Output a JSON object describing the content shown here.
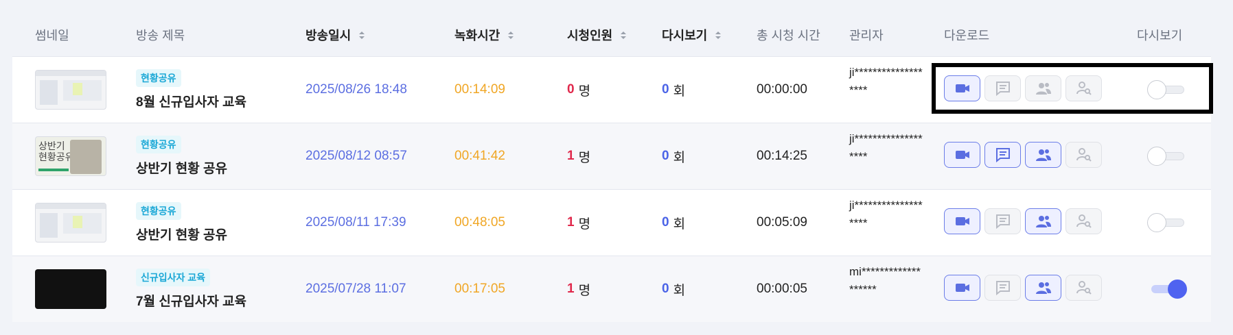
{
  "headers": {
    "thumbnail": "썸네일",
    "title": "방송 제목",
    "date": "방송일시",
    "rec_time": "녹화시간",
    "viewers": "시청인원",
    "replays": "다시보기",
    "total_time": "총 시청 시간",
    "admin": "관리자",
    "download": "다운로드",
    "replay_toggle": "다시보기"
  },
  "colors": {
    "date": "#5b6ee1",
    "rec_time": "#f0a624",
    "viewer_count": "#e0284b",
    "replay_count": "#4a63e7",
    "tag_text": "#19a7d6",
    "button_active": "#6a7ce8",
    "toggle_on": "#4f63f0"
  },
  "rows": [
    {
      "thumb_type": "slide",
      "tag": "현황공유",
      "title": "8월 신규입사자 교육",
      "date": "2025/08/26 18:48",
      "rec_time": "00:14:09",
      "viewers_num": "0",
      "viewers_unit": "명",
      "replays_num": "0",
      "replays_unit": "회",
      "total_time": "00:00:00",
      "admin": "ji*******************",
      "buttons": {
        "video": true,
        "chat": false,
        "attendees": false,
        "search_user": false
      },
      "replay_enabled": false
    },
    {
      "thumb_type": "promo",
      "thumb_text": "상반기\n현황공유",
      "tag": "현황공유",
      "title": "상반기 현황 공유",
      "date": "2025/08/12 08:57",
      "rec_time": "00:41:42",
      "viewers_num": "1",
      "viewers_unit": "명",
      "replays_num": "0",
      "replays_unit": "회",
      "total_time": "00:14:25",
      "admin": "ji*******************",
      "buttons": {
        "video": true,
        "chat": true,
        "attendees": true,
        "search_user": false
      },
      "replay_enabled": false
    },
    {
      "thumb_type": "slide",
      "tag": "현황공유",
      "title": "상반기 현황 공유",
      "date": "2025/08/11 17:39",
      "rec_time": "00:48:05",
      "viewers_num": "1",
      "viewers_unit": "명",
      "replays_num": "0",
      "replays_unit": "회",
      "total_time": "00:05:09",
      "admin": "ji*******************",
      "buttons": {
        "video": true,
        "chat": false,
        "attendees": true,
        "search_user": false
      },
      "replay_enabled": false
    },
    {
      "thumb_type": "dark",
      "tag": "신규입사자 교육",
      "title": "7월 신규입사자 교육",
      "date": "2025/07/28 11:07",
      "rec_time": "00:17:05",
      "viewers_num": "1",
      "viewers_unit": "명",
      "replays_num": "0",
      "replays_unit": "회",
      "total_time": "00:00:05",
      "admin": "mi*******************",
      "buttons": {
        "video": true,
        "chat": false,
        "attendees": true,
        "search_user": false
      },
      "replay_enabled": true
    }
  ]
}
